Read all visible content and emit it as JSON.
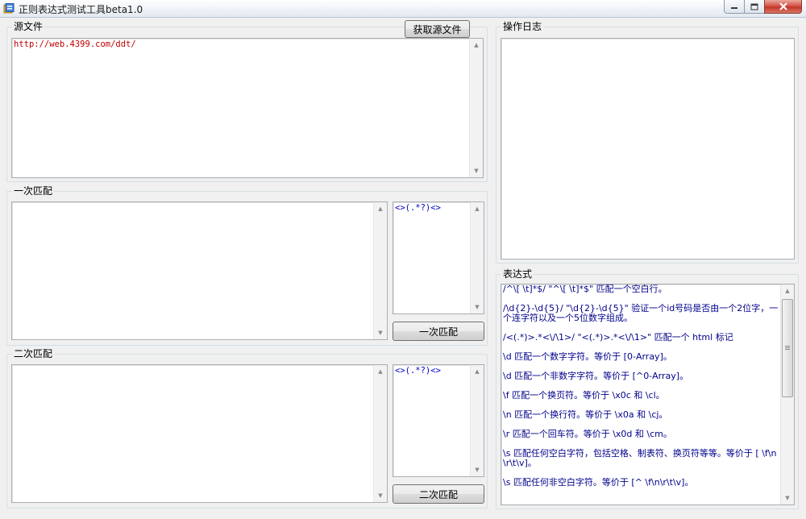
{
  "window": {
    "title": "正则表达式测试工具beta1.0"
  },
  "source_group": {
    "legend": "源文件",
    "fetch_button": "获取源文件",
    "value": "http://web.4399.com/ddt/"
  },
  "first_match": {
    "legend": "一次匹配",
    "result": "",
    "pattern": "<>(.*?)<>",
    "button": "一次匹配"
  },
  "second_match": {
    "legend": "二次匹配",
    "result": "",
    "pattern": "<>(.*?)<>",
    "button": "二次匹配"
  },
  "log_group": {
    "legend": "操作日志",
    "value": ""
  },
  "expression_group": {
    "legend": "表达式",
    "items": [
      "/^\\[ \\t]*$/ \"^\\[ \\t]*$\" 匹配一个空白行。",
      "/\\d{2}-\\d{5}/ \"\\d{2}-\\d{5}\" 验证一个id号码是否由一个2位字，一个连字符以及一个5位数字组成。",
      "/<(.*)>.*<\\/\\1>/ \"<(.*)>.*<\\/\\1>\" 匹配一个 html 标记",
      "\\d 匹配一个数字字符。等价于 [0-Array]。",
      "\\d 匹配一个非数字字符。等价于 [^0-Array]。",
      "\\f 匹配一个换页符。等价于 \\x0c 和 \\cl。",
      "\\n 匹配一个换行符。等价于 \\x0a 和 \\cj。",
      "\\r 匹配一个回车符。等价于 \\x0d 和 \\cm。",
      "\\s 匹配任何空白字符，包括空格、制表符、换页符等等。等价于 [ \\f\\n\\r\\t\\v]。",
      "\\s 匹配任何非空白字符。等价于 [^ \\f\\n\\r\\t\\v]。"
    ]
  },
  "icons": {
    "app": "app-icon",
    "minimize": "minimize-icon",
    "maximize": "maximize-icon",
    "close": "close-icon",
    "scroll_up": "chevron-up-icon",
    "scroll_down": "chevron-down-icon"
  },
  "colors": {
    "source_text": "#c00000",
    "pattern_text": "#0000cc",
    "expression_text": "#00008b",
    "close_button": "#c23728"
  }
}
